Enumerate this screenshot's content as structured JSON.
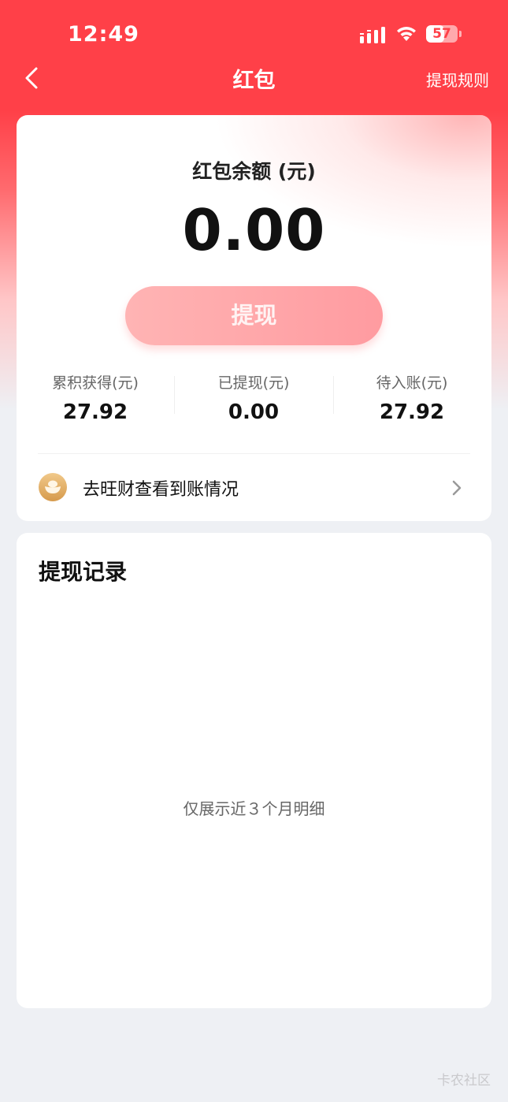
{
  "status_bar": {
    "time": "12:49",
    "battery": "57",
    "battery_level": 0.57
  },
  "nav": {
    "title": "红包",
    "right_link": "提现规则",
    "icons": [
      "back-arrow-icon"
    ]
  },
  "balance": {
    "label": "红包余额 (元)",
    "value": "0.00",
    "withdraw_button": "提现"
  },
  "stats": [
    {
      "label": "累积获得(元)",
      "value": "27.92"
    },
    {
      "label": "已提现(元)",
      "value": "0.00"
    },
    {
      "label": "待入账(元)",
      "value": "27.92"
    }
  ],
  "wangcai": {
    "text": "去旺财查看到账情况",
    "icons": [
      "coin-icon",
      "chevron-right-icon"
    ]
  },
  "records": {
    "title": "提现记录",
    "note": "仅展示近３个月明细"
  },
  "watermark": "卡农社区",
  "colors": {
    "primary_red": "#ff4048",
    "button_pink": "#ffa6aa",
    "background": "#eef0f4"
  }
}
